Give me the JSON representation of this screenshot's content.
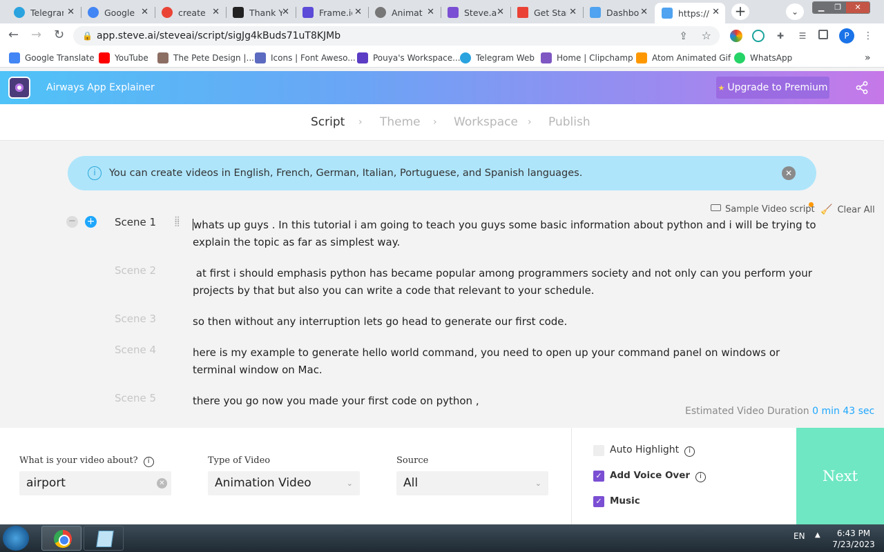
{
  "browser": {
    "tabs": [
      {
        "label": "Telegram",
        "color": "#2aa3df"
      },
      {
        "label": "Google",
        "color": "#4285f4"
      },
      {
        "label": "create",
        "color": "#ea4335"
      },
      {
        "label": "Thank You",
        "color": "#222222"
      },
      {
        "label": "Frame.io",
        "color": "#5b4bd8"
      },
      {
        "label": "Animat",
        "color": "#555555"
      },
      {
        "label": "Steve.ai",
        "color": "#7b4fd3"
      },
      {
        "label": "Get Start",
        "color": "#ea4335"
      },
      {
        "label": "Dashbo",
        "color": "#4fa3f0"
      },
      {
        "label": "https://",
        "color": "#4fa3f0"
      }
    ],
    "url": "app.steve.ai/steveai/script/sigJg4kBuds71uT8KJMb",
    "profile_initial": "P",
    "bookmarks": [
      {
        "label": "Google Translate",
        "color": "#4285f4"
      },
      {
        "label": "YouTube",
        "color": "#ff0000"
      },
      {
        "label": "The Pete Design |...",
        "color": "#8d6e63"
      },
      {
        "label": "Icons | Font Aweso...",
        "color": "#5c6bc0"
      },
      {
        "label": "Pouya's Workspace...",
        "color": "#5b3cc4"
      },
      {
        "label": "Telegram Web",
        "color": "#2aa3df"
      },
      {
        "label": "Home | Clipchamp",
        "color": "#7e57c2"
      },
      {
        "label": "Atom Animated Gif",
        "color": "#ff9800"
      },
      {
        "label": "WhatsApp",
        "color": "#25d366"
      }
    ],
    "bookmarks_more": "»"
  },
  "app": {
    "title": "Airways App Explainer",
    "upgrade_label": "Upgrade to Premium",
    "steps": [
      "Script",
      "Theme",
      "Workspace",
      "Publish"
    ],
    "banner_text": "You can create videos in English, French, German, Italian, Portuguese, and Spanish languages.",
    "sample_script_label": "Sample Video script",
    "clear_all_label": "Clear All",
    "scenes": [
      {
        "label": "Scene 1",
        "text": "whats up guys . In this tutorial i am going to teach you guys some basic information about python and i will be trying to explain the topic as far as simplest way."
      },
      {
        "label": "Scene 2",
        "text": " at first i should emphasis python has became popular among programmers society and not only can you perform your projects by that but also you can write a code that relevant to your schedule."
      },
      {
        "label": "Scene 3",
        "text": "so then without any interruption lets go head to generate our first code."
      },
      {
        "label": "Scene 4",
        "text": "here is my example to generate hello world command, you need to open up your command panel on windows or terminal window on Mac."
      },
      {
        "label": "Scene 5",
        "text": "there you go now you made your first code on python ,"
      }
    ],
    "duration_label": "Estimated Video Duration",
    "duration_value": "0 min 43 sec",
    "form": {
      "about_label": "What is your video about?",
      "about_value": "airport",
      "type_label": "Type of Video",
      "type_value": "Animation Video",
      "source_label": "Source",
      "source_value": "All"
    },
    "options": {
      "auto_highlight": "Auto Highlight",
      "voice_over": "Add Voice Over",
      "music": "Music"
    },
    "next_label": "Next"
  },
  "taskbar": {
    "language": "EN",
    "time": "6:43 PM",
    "date": "7/23/2023"
  }
}
